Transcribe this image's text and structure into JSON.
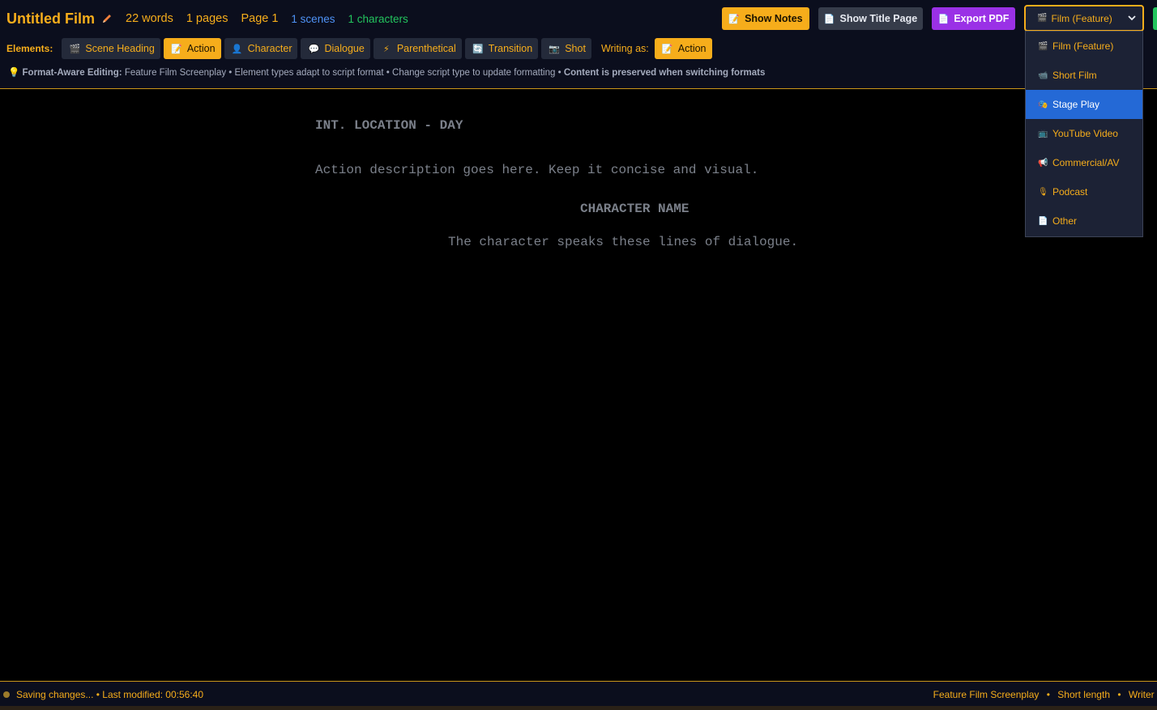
{
  "header": {
    "title": "Untitled Film",
    "words": "22 words",
    "pages": "1 pages",
    "page": "Page 1",
    "scenes": "1 scenes",
    "characters": "1 characters"
  },
  "buttons": {
    "notes": "Show Notes",
    "title_page": "Show Title Page",
    "export": "Export PDF"
  },
  "format_select": {
    "value": "Film (Feature)",
    "options": [
      {
        "label": "Film (Feature)",
        "icon": "clapper-icon"
      },
      {
        "label": "Short Film",
        "icon": "camera-icon"
      },
      {
        "label": "Stage Play",
        "icon": "theater-icon"
      },
      {
        "label": "YouTube Video",
        "icon": "video-icon"
      },
      {
        "label": "Commercial/AV",
        "icon": "megaphone-icon"
      },
      {
        "label": "Podcast",
        "icon": "microphone-icon"
      },
      {
        "label": "Other",
        "icon": "document-icon"
      }
    ],
    "highlighted": "Stage Play"
  },
  "elements": {
    "label": "Elements:",
    "items": [
      {
        "label": "Scene Heading",
        "icon": "clapper-icon"
      },
      {
        "label": "Action",
        "icon": "memo-icon"
      },
      {
        "label": "Character",
        "icon": "person-icon"
      },
      {
        "label": "Dialogue",
        "icon": "speech-bubble-icon"
      },
      {
        "label": "Parenthetical",
        "icon": "lightning-icon"
      },
      {
        "label": "Transition",
        "icon": "refresh-icon"
      },
      {
        "label": "Shot",
        "icon": "camera-icon"
      }
    ],
    "active": "Action",
    "writing_as_label": "Writing as:",
    "writing_as_value": "Action"
  },
  "info": {
    "lead": "Format-Aware Editing:",
    "text": " Feature Film Screenplay • Element types adapt to script format • Change script type to update formatting • ",
    "tail": "Content is preserved when switching formats"
  },
  "script": {
    "scene_heading": "INT. LOCATION - DAY",
    "action": "Action description goes here. Keep it concise and visual.",
    "character": "CHARACTER NAME",
    "dialogue": "The character speaks these lines of dialogue."
  },
  "status": {
    "left": "Saving changes... • Last modified: 00:56:40",
    "right_1": "Feature Film Screenplay",
    "right_2": "Short length",
    "right_3": "Writer M"
  },
  "colors": {
    "accent": "#f6ad1b",
    "scene_count": "#4f93f7",
    "character_count": "#23c55e",
    "export": "#9a31e6",
    "dropdown_highlight": "#2469d6"
  }
}
